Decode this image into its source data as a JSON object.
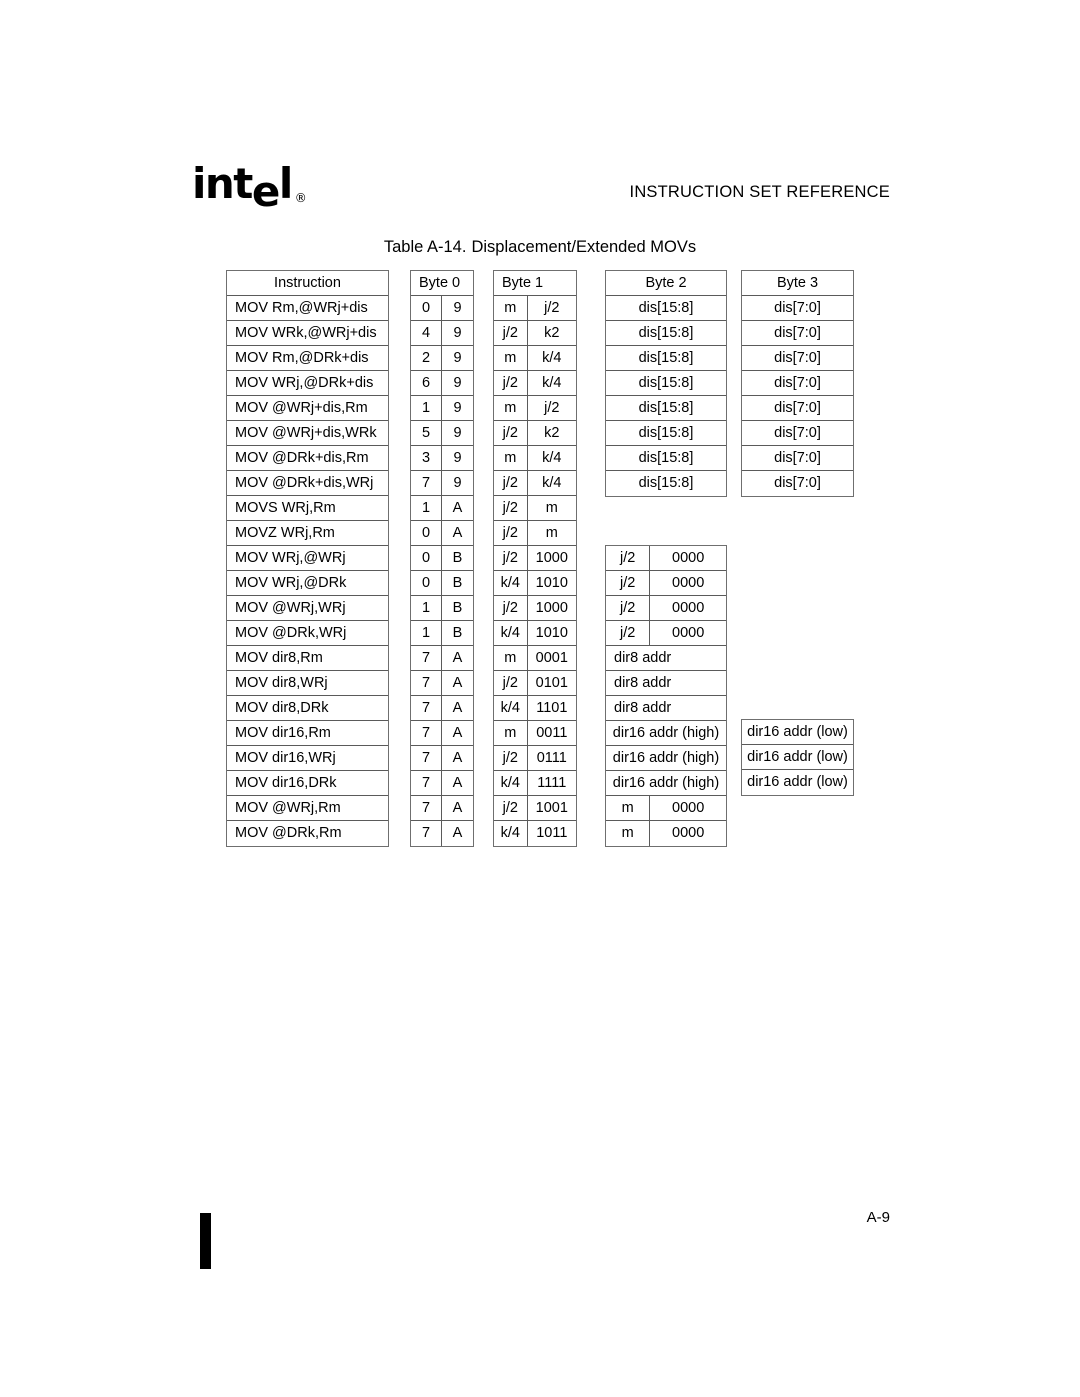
{
  "header": {
    "logo_text": "intel",
    "logo_mark": "®",
    "title": "INSTRUCTION SET REFERENCE"
  },
  "caption": {
    "number": "Table A-14.",
    "text": "Displacement/Extended MOVs"
  },
  "footer": {
    "page_number": "A-9"
  },
  "table": {
    "headers": {
      "instruction": "Instruction",
      "byte0": "Byte 0",
      "byte1": "Byte 1",
      "byte2": "Byte 2",
      "byte3": "Byte 3"
    },
    "rows": [
      {
        "instruction": "MOV Rm,@WRj+dis",
        "byte0": [
          "0",
          "9"
        ],
        "byte1": [
          "m",
          "j/2"
        ],
        "byte2": [
          "dis[15:8]"
        ],
        "byte3": "dis[7:0]"
      },
      {
        "instruction": "MOV WRk,@WRj+dis",
        "byte0": [
          "4",
          "9"
        ],
        "byte1": [
          "j/2",
          "k2"
        ],
        "byte2": [
          "dis[15:8]"
        ],
        "byte3": "dis[7:0]"
      },
      {
        "instruction": "MOV Rm,@DRk+dis",
        "byte0": [
          "2",
          "9"
        ],
        "byte1": [
          "m",
          "k/4"
        ],
        "byte2": [
          "dis[15:8]"
        ],
        "byte3": "dis[7:0]"
      },
      {
        "instruction": "MOV WRj,@DRk+dis",
        "byte0": [
          "6",
          "9"
        ],
        "byte1": [
          "j/2",
          "k/4"
        ],
        "byte2": [
          "dis[15:8]"
        ],
        "byte3": "dis[7:0]"
      },
      {
        "instruction": "MOV @WRj+dis,Rm",
        "byte0": [
          "1",
          "9"
        ],
        "byte1": [
          "m",
          "j/2"
        ],
        "byte2": [
          "dis[15:8]"
        ],
        "byte3": "dis[7:0]"
      },
      {
        "instruction": "MOV @WRj+dis,WRk",
        "byte0": [
          "5",
          "9"
        ],
        "byte1": [
          "j/2",
          "k2"
        ],
        "byte2": [
          "dis[15:8]"
        ],
        "byte3": "dis[7:0]"
      },
      {
        "instruction": "MOV @DRk+dis,Rm",
        "byte0": [
          "3",
          "9"
        ],
        "byte1": [
          "m",
          "k/4"
        ],
        "byte2": [
          "dis[15:8]"
        ],
        "byte3": "dis[7:0]"
      },
      {
        "instruction": "MOV @DRk+dis,WRj",
        "byte0": [
          "7",
          "9"
        ],
        "byte1": [
          "j/2",
          "k/4"
        ],
        "byte2": [
          "dis[15:8]"
        ],
        "byte3": "dis[7:0]"
      },
      {
        "instruction": "MOVS WRj,Rm",
        "byte0": [
          "1",
          "A"
        ],
        "byte1": [
          "j/2",
          "m"
        ],
        "byte2": null,
        "byte3": null
      },
      {
        "instruction": "MOVZ WRj,Rm",
        "byte0": [
          "0",
          "A"
        ],
        "byte1": [
          "j/2",
          "m"
        ],
        "byte2": null,
        "byte3": null
      },
      {
        "instruction": "MOV WRj,@WRj",
        "byte0": [
          "0",
          "B"
        ],
        "byte1": [
          "j/2",
          "1000"
        ],
        "byte2": [
          "j/2",
          "0000"
        ],
        "byte3": null
      },
      {
        "instruction": "MOV WRj,@DRk",
        "byte0": [
          "0",
          "B"
        ],
        "byte1": [
          "k/4",
          "1010"
        ],
        "byte2": [
          "j/2",
          "0000"
        ],
        "byte3": null
      },
      {
        "instruction": "MOV @WRj,WRj",
        "byte0": [
          "1",
          "B"
        ],
        "byte1": [
          "j/2",
          "1000"
        ],
        "byte2": [
          "j/2",
          "0000"
        ],
        "byte3": null
      },
      {
        "instruction": "MOV @DRk,WRj",
        "byte0": [
          "1",
          "B"
        ],
        "byte1": [
          "k/4",
          "1010"
        ],
        "byte2": [
          "j/2",
          "0000"
        ],
        "byte3": null
      },
      {
        "instruction": "MOV dir8,Rm",
        "byte0": [
          "7",
          "A"
        ],
        "byte1": [
          "m",
          "0001"
        ],
        "byte2": [
          "dir8 addr"
        ],
        "byte3": null
      },
      {
        "instruction": "MOV dir8,WRj",
        "byte0": [
          "7",
          "A"
        ],
        "byte1": [
          "j/2",
          "0101"
        ],
        "byte2": [
          "dir8 addr"
        ],
        "byte3": null
      },
      {
        "instruction": "MOV dir8,DRk",
        "byte0": [
          "7",
          "A"
        ],
        "byte1": [
          "k/4",
          "1101"
        ],
        "byte2": [
          "dir8 addr"
        ],
        "byte3": null
      },
      {
        "instruction": "MOV dir16,Rm",
        "byte0": [
          "7",
          "A"
        ],
        "byte1": [
          "m",
          "0011"
        ],
        "byte2": [
          "dir16 addr (high)"
        ],
        "byte3": "dir16 addr (low)"
      },
      {
        "instruction": "MOV dir16,WRj",
        "byte0": [
          "7",
          "A"
        ],
        "byte1": [
          "j/2",
          "0111"
        ],
        "byte2": [
          "dir16 addr (high)"
        ],
        "byte3": "dir16 addr (low)"
      },
      {
        "instruction": "MOV dir16,DRk",
        "byte0": [
          "7",
          "A"
        ],
        "byte1": [
          "k/4",
          "1111"
        ],
        "byte2": [
          "dir16 addr (high)"
        ],
        "byte3": "dir16 addr (low)"
      },
      {
        "instruction": "MOV @WRj,Rm",
        "byte0": [
          "7",
          "A"
        ],
        "byte1": [
          "j/2",
          "1001"
        ],
        "byte2": [
          "m",
          "0000"
        ],
        "byte3": null
      },
      {
        "instruction": "MOV @DRk,Rm",
        "byte0": [
          "7",
          "A"
        ],
        "byte1": [
          "k/4",
          "1011"
        ],
        "byte2": [
          "m",
          "0000"
        ],
        "byte3": null
      }
    ]
  }
}
